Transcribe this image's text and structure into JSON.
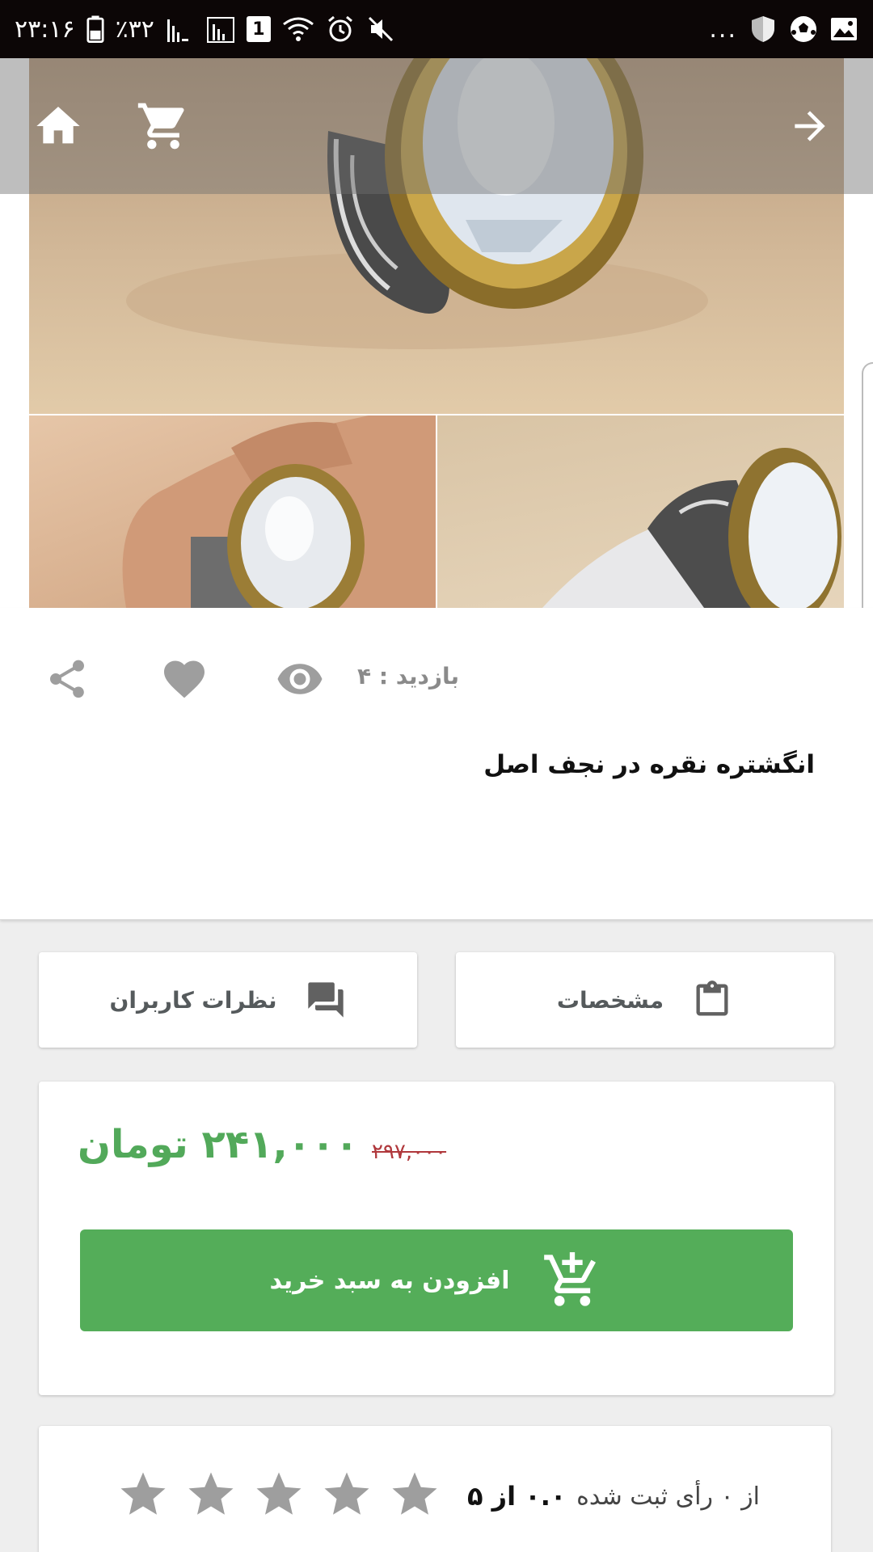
{
  "status_bar": {
    "time": "۲۳:۱۶",
    "battery_percent": "٪۳۲",
    "sim_slot": "1",
    "overflow": "..."
  },
  "toolbar": {
    "home_icon": "home-icon",
    "cart_icon": "cart-icon",
    "back_icon": "arrow-forward-icon"
  },
  "product": {
    "title": "انگشتره نقره در نجف اصل",
    "visits_label": "بازدید : ۴",
    "images": [
      "silver-ring-main-photo",
      "ring-on-finger-photo",
      "ring-side-photo"
    ]
  },
  "tabs": [
    {
      "label": "مشخصات",
      "icon": "clipboard-icon"
    },
    {
      "label": "نظرات کاربران",
      "icon": "chat-icon"
    }
  ],
  "pricing": {
    "current_price": "۲۴۱,۰۰۰ تومان",
    "old_price": "۲۹۷,۰۰۰",
    "add_to_cart_label": "افزودن به سبد خرید",
    "current_price_color": "#52a95a",
    "button_color": "#54ad59",
    "old_price_color": "#b0383c"
  },
  "rating": {
    "score_label": "۰.۰ از ۵",
    "count_label": "از ۰ رأی ثبت شده",
    "stars_filled": 0,
    "stars_total": 5
  }
}
